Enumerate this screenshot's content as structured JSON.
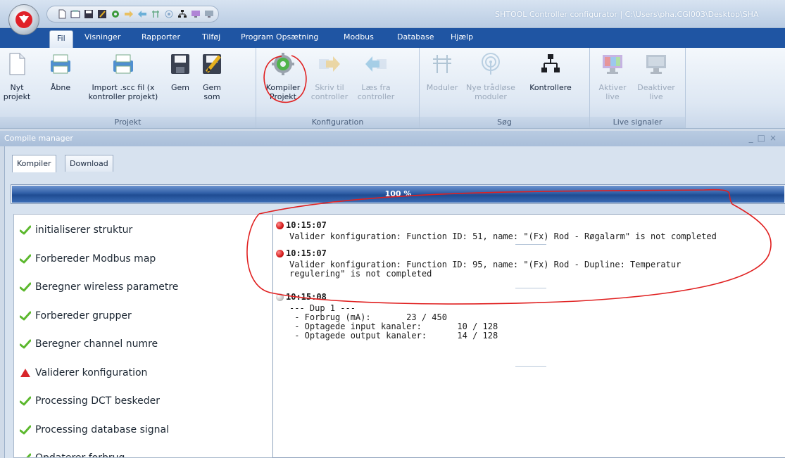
{
  "window": {
    "title": "SHTOOL Controller configurator | C:\\Users\\pha.CGI003\\Desktop\\SHA"
  },
  "quick_access": {
    "icons": [
      "new-icon",
      "open-icon",
      "save-icon",
      "save-as-icon",
      "compile-icon",
      "write-icon",
      "read-icon",
      "modules-icon",
      "wireless-icon",
      "network-icon",
      "live-icon",
      "deactivate-icon"
    ]
  },
  "ribbon_tabs": [
    {
      "label": "Fil",
      "active": true
    },
    {
      "label": "Visninger"
    },
    {
      "label": "Rapporter"
    },
    {
      "label": "Tilføj"
    },
    {
      "label": "Program Opsætning"
    },
    {
      "label": "Modbus"
    },
    {
      "label": "Database"
    },
    {
      "label": "Hjælp"
    }
  ],
  "ribbon_groups": [
    {
      "label": "Projekt",
      "buttons": [
        {
          "label_line1": "Nyt",
          "label_line2": "projekt",
          "icon": "new-project-icon"
        },
        {
          "label_line1": "Åbne",
          "label_line2": "",
          "icon": "open-icon"
        },
        {
          "label_line1": "Import .scc fil (x",
          "label_line2": "kontroller projekt)",
          "icon": "import-icon"
        },
        {
          "label_line1": "Gem",
          "label_line2": "",
          "icon": "save-icon"
        },
        {
          "label_line1": "Gem",
          "label_line2": "som",
          "icon": "save-as-icon"
        }
      ]
    },
    {
      "label": "Konfiguration",
      "buttons": [
        {
          "label_line1": "Kompiler",
          "label_line2": "Projekt",
          "icon": "compile-icon"
        },
        {
          "label_line1": "Skriv til",
          "label_line2": "controller",
          "icon": "write-icon",
          "disabled": true
        },
        {
          "label_line1": "Læs fra",
          "label_line2": "controller",
          "icon": "read-icon",
          "disabled": true
        }
      ]
    },
    {
      "label": "Søg",
      "buttons": [
        {
          "label_line1": "Moduler",
          "label_line2": "",
          "icon": "modules-icon",
          "disabled": true
        },
        {
          "label_line1": "Nye trådløse",
          "label_line2": "moduler",
          "icon": "wireless-icon",
          "disabled": true
        },
        {
          "label_line1": "Kontrollere",
          "label_line2": "",
          "icon": "network-icon"
        }
      ]
    },
    {
      "label": "Live signaler",
      "buttons": [
        {
          "label_line1": "Aktiver",
          "label_line2": "live",
          "icon": "monitor-on-icon",
          "disabled": true
        },
        {
          "label_line1": "Deaktiver",
          "label_line2": "live",
          "icon": "monitor-off-icon",
          "disabled": true
        }
      ]
    }
  ],
  "panel": {
    "title": "Compile manager",
    "tabs": [
      {
        "label": "Kompiler",
        "active": true
      },
      {
        "label": "Download"
      }
    ],
    "progress": {
      "percent": 100,
      "label": "100 %"
    }
  },
  "steps": [
    {
      "label": "initialiserer struktur",
      "status": "ok"
    },
    {
      "label": "Forbereder Modbus map",
      "status": "ok"
    },
    {
      "label": "Beregner wireless parametre",
      "status": "ok"
    },
    {
      "label": "Forbereder grupper",
      "status": "ok"
    },
    {
      "label": "Beregner channel numre",
      "status": "ok"
    },
    {
      "label": "Validerer konfiguration",
      "status": "warning"
    },
    {
      "label": "Processing DCT beskeder",
      "status": "ok"
    },
    {
      "label": "Processing database signal",
      "status": "ok"
    },
    {
      "label": "Opdaterer forbrug",
      "status": "ok"
    }
  ],
  "log": [
    {
      "time": "10:15:07",
      "level": "error",
      "lines": [
        "Valider konfiguration: Function ID: 51, name: \"(Fx) Rod - Røgalarm\" is not completed"
      ]
    },
    {
      "time": "10:15:07",
      "level": "error",
      "lines": [
        "Valider konfiguration: Function ID: 95, name: \"(Fx) Rod - Dupline: Temperatur",
        "regulering\" is not completed"
      ]
    },
    {
      "time": "10:15:08",
      "level": "info",
      "lines": [
        "--- Dup 1 ---",
        " - Forbrug (mA):       23 / 450",
        " - Optagede input kanaler:       10 / 128",
        " - Optagede output kanaler:      14 / 128"
      ]
    }
  ],
  "colors": {
    "accent": "#1f55a3",
    "ok": "#5cb82e",
    "warning": "#d8262a",
    "annotation": "#e02020"
  }
}
